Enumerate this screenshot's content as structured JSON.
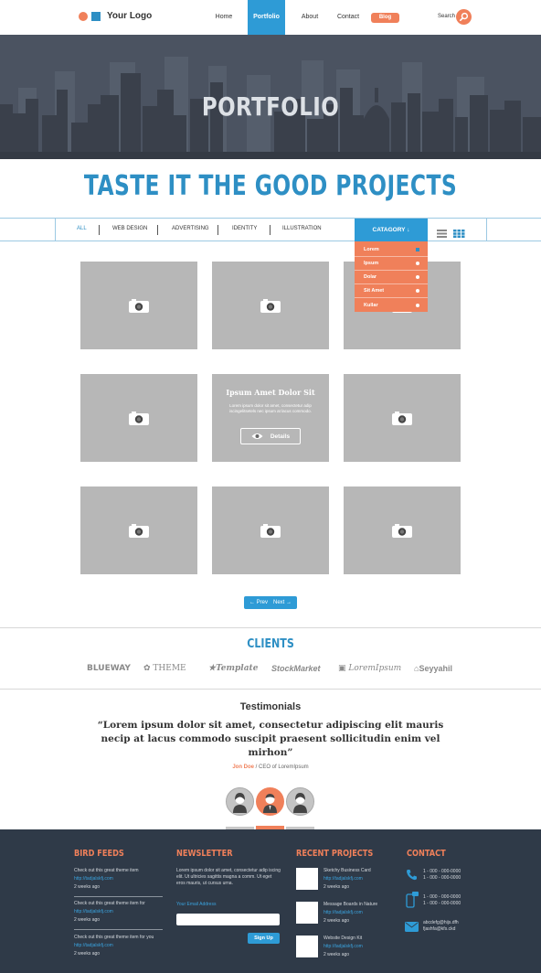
{
  "header": {
    "logo_text": "Your Logo",
    "nav": [
      "Home",
      "Portfolio",
      "About",
      "Contact",
      "Blog"
    ],
    "active_nav": "Portfolio",
    "search_label": "Search"
  },
  "hero": {
    "title": "PORTFOLIO"
  },
  "headline": "TASTE IT THE GOOD PROJECTS",
  "filters": [
    "ALL",
    "WEB DESIGN",
    "ADVERTISING",
    "IDENTITY",
    "ILLUSTRATION"
  ],
  "category": {
    "label": "CATAGORY",
    "options": [
      "Lorem",
      "Ipsum",
      "Dolar",
      "Sit Amet",
      "Kullar"
    ]
  },
  "grid": {
    "hover_title": "Ipsum Amet Dolor Sit",
    "hover_desc": "Lorem ipsum dolor sit amet, consectetur adip iscingelitsetels nec ipsum at lacus commodo.",
    "details_label": "Details"
  },
  "pager": {
    "prev": "Prev",
    "next": "Next"
  },
  "clients": {
    "title": "CLIENTS",
    "logos": [
      "BLUEWAY",
      "THEME",
      "Template",
      "StockMarket",
      "LoremIpsum",
      "Seyyahil"
    ]
  },
  "testimonials": {
    "title": "Testimonials",
    "quote": "“Lorem ipsum dolor sit amet, consectetur adipiscing elit mauris necip at lacus commodo suscipit praesent sollicitudin enim vel mirhon”",
    "author": "Jon Doe",
    "role": " / CEO of LoremIpsum"
  },
  "footer": {
    "bird_feeds": {
      "title": "BIRD FEEDS",
      "items": [
        {
          "text": "Check out this great theme item",
          "link": "http://tadjalskfj.com",
          "time": "2 weeks ago"
        },
        {
          "text": "Check out this great theme item for",
          "link": "http://tadjalskfj.com",
          "time": "2 weeks ago"
        },
        {
          "text": "Check out this great theme item for you",
          "link": "http://tadjalskfj.com",
          "time": "2 weeks ago"
        }
      ]
    },
    "newsletter": {
      "title": "NEWSLETTER",
      "text": "Lorem ipsum dolor sit amet, consectetur adip iscing elit. Ut ultricies sagittis magna a comm. Ut eget eros mauris, ut cursus urna.",
      "email_label": "Your Email Address",
      "signup": "Sign Up"
    },
    "recent_projects": {
      "title": "RECENT PROJECTS",
      "items": [
        {
          "name": "Sketchy Business Card",
          "link": "http://tadjalskfj.com",
          "time": "2 weeks ago"
        },
        {
          "name": "Message Boards in Nature",
          "link": "http://tadjalskfj.com",
          "time": "2 weeks ago"
        },
        {
          "name": "Website Design Kit",
          "link": "http://tadjalskfj.com",
          "time": "2 weeks ago"
        }
      ]
    },
    "contact": {
      "title": "CONTACT",
      "phone1": "1 - 000 - 000-0000",
      "phone2": "1 - 000 - 000-0000",
      "mobile1": "1 - 000 - 000-0000",
      "mobile2": "1 - 000 - 000-0000",
      "email1": "abcdefg@hijs.dfh",
      "email2": "fjashfa@kfs.ckd"
    }
  },
  "colors": {
    "blue": "#2e9bd6",
    "orange": "#f0805a",
    "footer_bg": "#2f3a48",
    "tile": "#b7b7b7"
  }
}
